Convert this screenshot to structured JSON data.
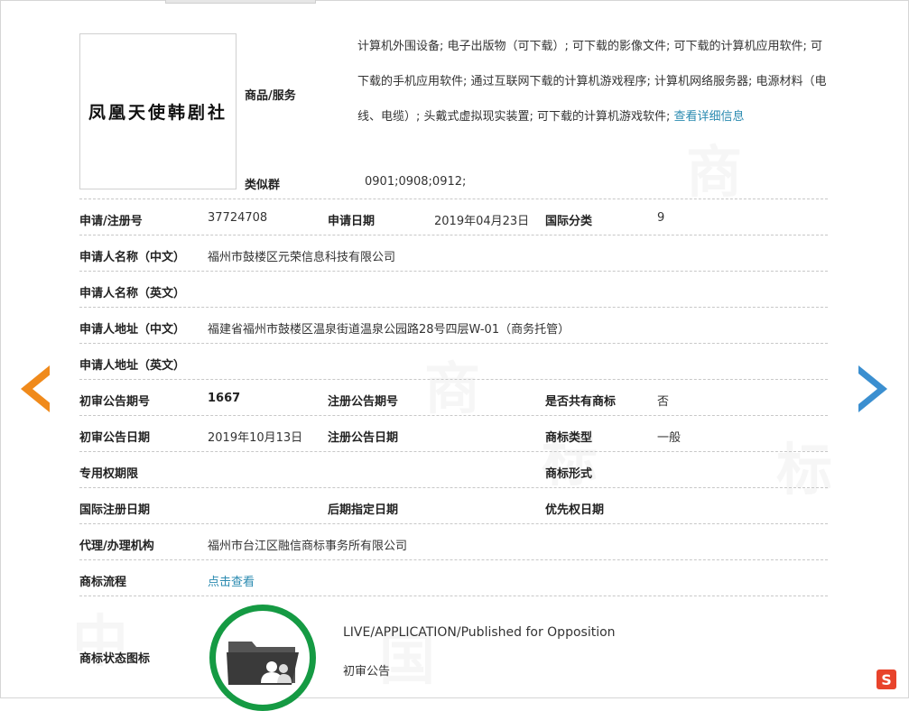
{
  "logo": {
    "text": "凤凰天使韩剧社"
  },
  "goods_services": {
    "label": "商品/服务",
    "text": "计算机外围设备; 电子出版物（可下载）; 可下载的影像文件; 可下载的计算机应用软件; 可下载的手机应用软件; 通过互联网下载的计算机游戏程序; 计算机网络服务器; 电源材料（电线、电缆）; 头戴式虚拟现实装置; 可下载的计算机游戏软件;",
    "link": "查看详细信息"
  },
  "similar_group": {
    "label": "类似群",
    "value": "0901;0908;0912;"
  },
  "registration_no": {
    "label": "申请/注册号",
    "value": "37724708"
  },
  "apply_date": {
    "label": "申请日期",
    "value": "2019年04月23日"
  },
  "intl_class": {
    "label": "国际分类",
    "value": "9"
  },
  "applicant_cn": {
    "label": "申请人名称（中文）",
    "value": "福州市鼓楼区元荣信息科技有限公司"
  },
  "applicant_en": {
    "label": "申请人名称（英文）",
    "value": ""
  },
  "address_cn": {
    "label": "申请人地址（中文）",
    "value": "福建省福州市鼓楼区温泉街道温泉公园路28号四层W-01（商务托管）"
  },
  "address_en": {
    "label": "申请人地址（英文）",
    "value": ""
  },
  "prelim_issue_no": {
    "label": "初审公告期号",
    "value": "1667"
  },
  "reg_issue_no": {
    "label": "注册公告期号",
    "value": ""
  },
  "shared": {
    "label": "是否共有商标",
    "value": "否"
  },
  "prelim_date": {
    "label": "初审公告日期",
    "value": "2019年10月13日"
  },
  "reg_date": {
    "label": "注册公告日期",
    "value": ""
  },
  "tm_type": {
    "label": "商标类型",
    "value": "一般"
  },
  "exclusive_period": {
    "label": "专用权期限",
    "value": ""
  },
  "tm_form": {
    "label": "商标形式",
    "value": ""
  },
  "intl_reg_date": {
    "label": "国际注册日期",
    "value": ""
  },
  "later_date": {
    "label": "后期指定日期",
    "value": ""
  },
  "priority_date": {
    "label": "优先权日期",
    "value": ""
  },
  "agency": {
    "label": "代理/办理机构",
    "value": "福州市台江区融信商标事务所有限公司"
  },
  "process": {
    "label": "商标流程",
    "link": "点击查看"
  },
  "status": {
    "label": "商标状态图标",
    "en": "LIVE/APPLICATION/Published for Opposition",
    "cn": "初审公告"
  },
  "watermark": [
    "商",
    "标",
    "商",
    "标",
    "中",
    "国"
  ],
  "ime_badge": "S",
  "colors": {
    "link": "#2a8ab0",
    "status_ring": "#159a43",
    "prev_arrow": "#f08a1b",
    "next_arrow": "#3b8fd0"
  }
}
